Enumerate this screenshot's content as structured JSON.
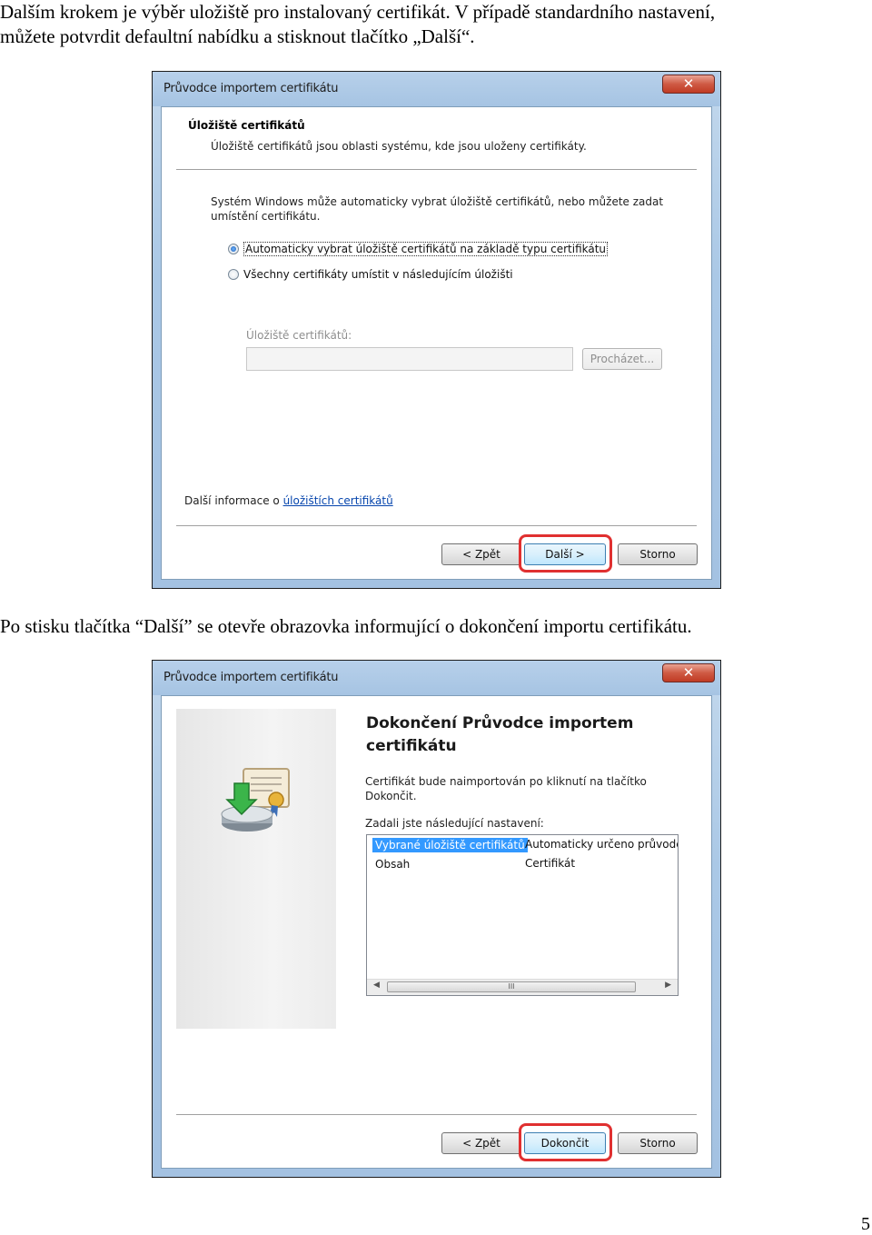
{
  "doc": {
    "para1_line1": "Dalším krokem je výběr uložiště pro instalovaný certifikát. V případě standardního nastavení,",
    "para1_line2": "můžete potvrdit defaultní nabídku a stisknout tlačítko „Další“.",
    "para2": "Po stisku tlačítka “Další” se otevře obrazovka informující o dokončení importu certifikátu.",
    "page_number": "5"
  },
  "dialog1": {
    "title": "Průvodce importem certifikátu",
    "close_symbol": "✕",
    "section_title": "Úložiště certifikátů",
    "section_desc": "Úložiště certifikátů jsou oblasti systému, kde jsou uloženy certifikáty.",
    "intro_line1": "Systém Windows může automaticky vybrat úložiště certifikátů, nebo můžete zadat",
    "intro_line2": "umístění certifikátu.",
    "radio_auto": "Automaticky vybrat úložiště certifikátů na základě typu certifikátu",
    "radio_manual": "Všechny certifikáty umístit v následujícím úložišti",
    "store_label": "Úložiště certifikátů:",
    "store_value": "",
    "browse": "Procházet...",
    "info_prefix": "Další informace o ",
    "info_link": "úložištích certifikátů",
    "back": "< Zpět",
    "next": "Další >",
    "cancel": "Storno"
  },
  "dialog2": {
    "title": "Průvodce importem certifikátu",
    "close_symbol": "✕",
    "heading_line1": "Dokončení Průvodce importem",
    "heading_line2": "certifikátu",
    "desc_line1": "Certifikát bude naimportován po kliknutí na tlačítko",
    "desc_line2": "Dokončit.",
    "settings_label": "Zadali jste následující nastavení:",
    "rows": [
      {
        "name": "Vybrané úložiště certifikátů",
        "value": "Automaticky určeno průvodc"
      },
      {
        "name": "Obsah",
        "value": "Certifikát"
      }
    ],
    "scroll_left": "◀",
    "scroll_right": "▶",
    "scroll_grip": "III",
    "back": "< Zpět",
    "finish": "Dokončit",
    "cancel": "Storno"
  }
}
